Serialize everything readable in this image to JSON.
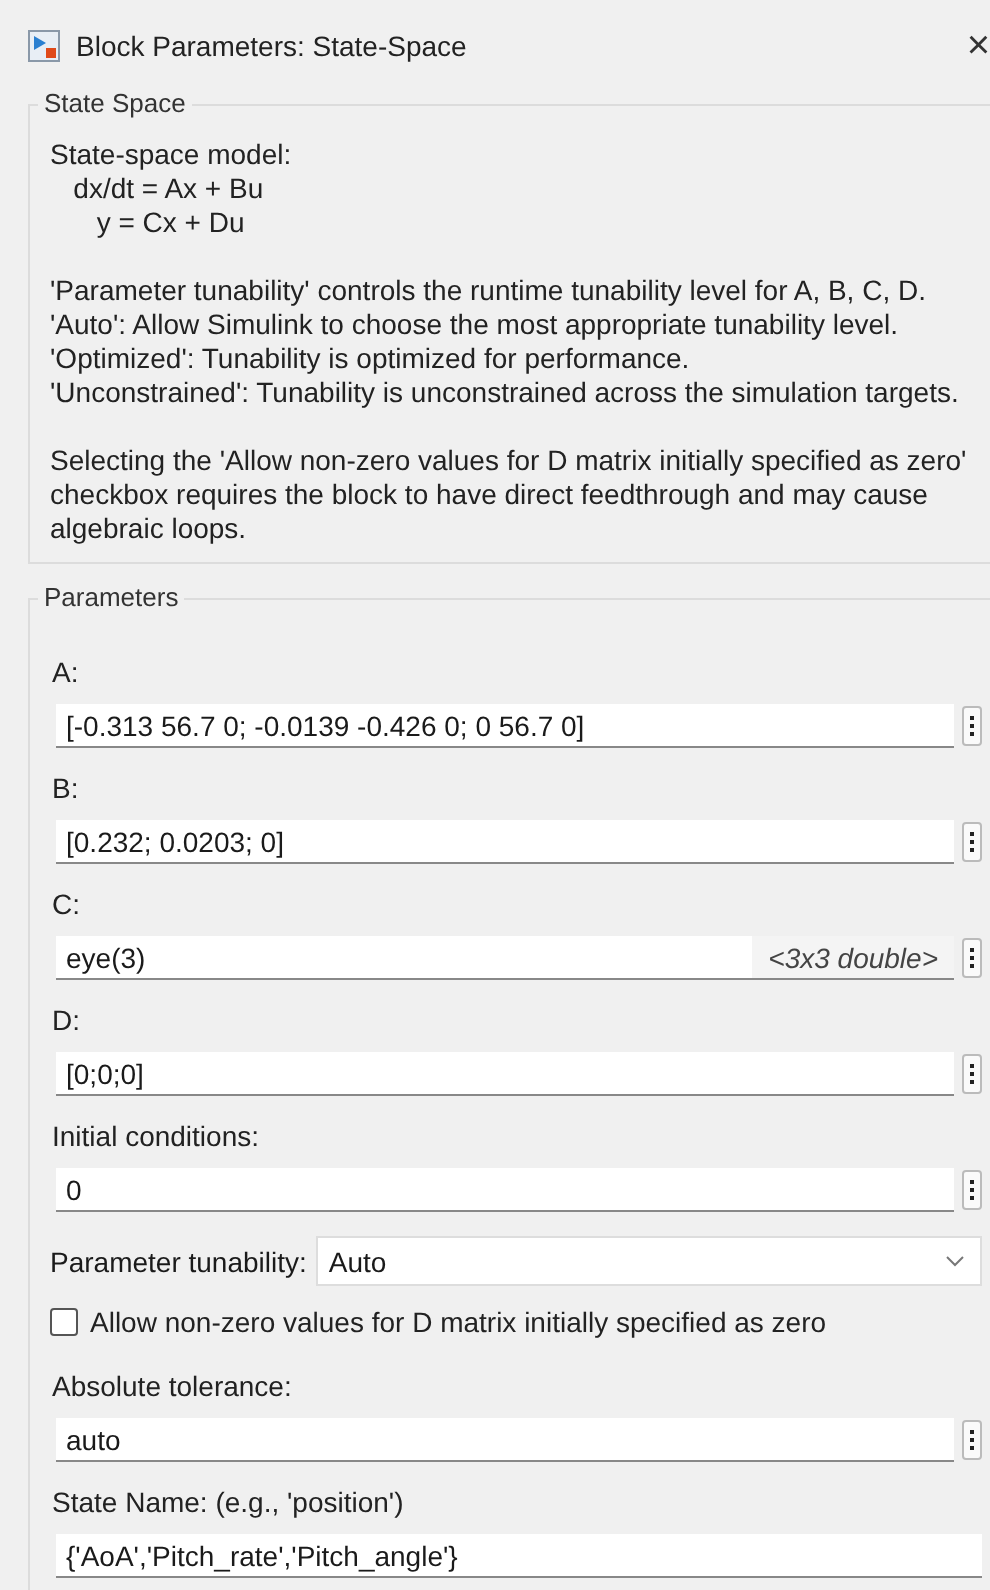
{
  "window": {
    "title": "Block Parameters: State-Space",
    "close": "×"
  },
  "description_group": {
    "label": "State Space",
    "paragraphs": [
      [
        "State-space model:",
        "   dx/dt = Ax + Bu",
        "      y = Cx + Du"
      ],
      [
        "'Parameter tunability' controls the runtime tunability level for A, B, C, D.",
        "'Auto': Allow Simulink to choose the most appropriate tunability level.",
        "'Optimized': Tunability is optimized for performance.",
        "'Unconstrained': Tunability is unconstrained across the simulation targets."
      ],
      [
        "Selecting the 'Allow non-zero values for D matrix initially specified as zero' checkbox requires the block to have direct feedthrough and may cause algebraic loops."
      ]
    ]
  },
  "parameters": {
    "label": "Parameters",
    "items": [
      {
        "kind": "field",
        "label": "A:",
        "value": "[-0.313 56.7 0; -0.0139 -0.426 0; 0 56.7 0]",
        "menu": true
      },
      {
        "kind": "field",
        "label": "B:",
        "value": "[0.232; 0.0203; 0]",
        "menu": true
      },
      {
        "kind": "field",
        "label": "C:",
        "value": "eye(3)",
        "hint": "<3x3 double>",
        "menu": true
      },
      {
        "kind": "field",
        "label": "D:",
        "value": "[0;0;0]",
        "menu": true
      },
      {
        "kind": "field",
        "label": "Initial conditions:",
        "value": "0",
        "menu": true
      },
      {
        "kind": "dropdown",
        "label": "Parameter tunability:",
        "value": "Auto"
      },
      {
        "kind": "checkbox",
        "label": "Allow non-zero values for D matrix initially specified as zero",
        "checked": false
      },
      {
        "kind": "field",
        "label": "Absolute tolerance:",
        "value": "auto",
        "menu": true
      },
      {
        "kind": "field",
        "label": "State Name: (e.g., 'position')",
        "value": "{'AoA','Pitch_rate','Pitch_angle'}",
        "menu": false
      }
    ]
  }
}
